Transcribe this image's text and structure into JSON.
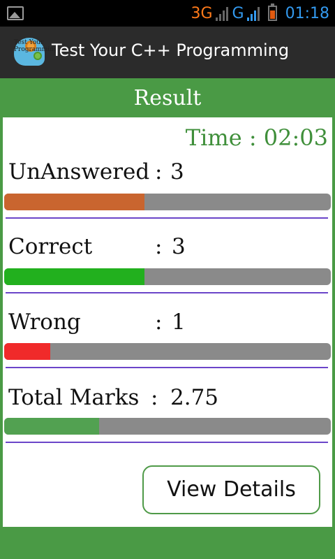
{
  "statusbar": {
    "network_1": "3G",
    "network_2": "G",
    "time": "01:18",
    "icons": [
      "image-notification-icon",
      "signal-icon",
      "battery-icon"
    ]
  },
  "actionbar": {
    "app_icon_text": "Test Your Programming",
    "title": "Test Your C++ Programming"
  },
  "page": {
    "title": "Result"
  },
  "timer": "Time : 02:03",
  "results": [
    {
      "label": "UnAnswered",
      "separator": ":",
      "value": "3",
      "progress": 0.43,
      "color": "#c9652f"
    },
    {
      "label": "Correct",
      "separator": ":",
      "value": "3",
      "progress": 0.43,
      "color": "#22b01e"
    },
    {
      "label": "Wrong",
      "separator": ":",
      "value": "1",
      "progress": 0.14,
      "color": "#f02a2a"
    },
    {
      "label": "Total Marks",
      "separator": ":",
      "value": "2.75",
      "progress": 0.29,
      "color": "#52a151"
    }
  ],
  "actions": {
    "view_details": "View Details"
  },
  "colors": {
    "accent_green": "#4a9a45",
    "divider_purple": "#6b45c9",
    "track_grey": "#8a8a8a"
  }
}
